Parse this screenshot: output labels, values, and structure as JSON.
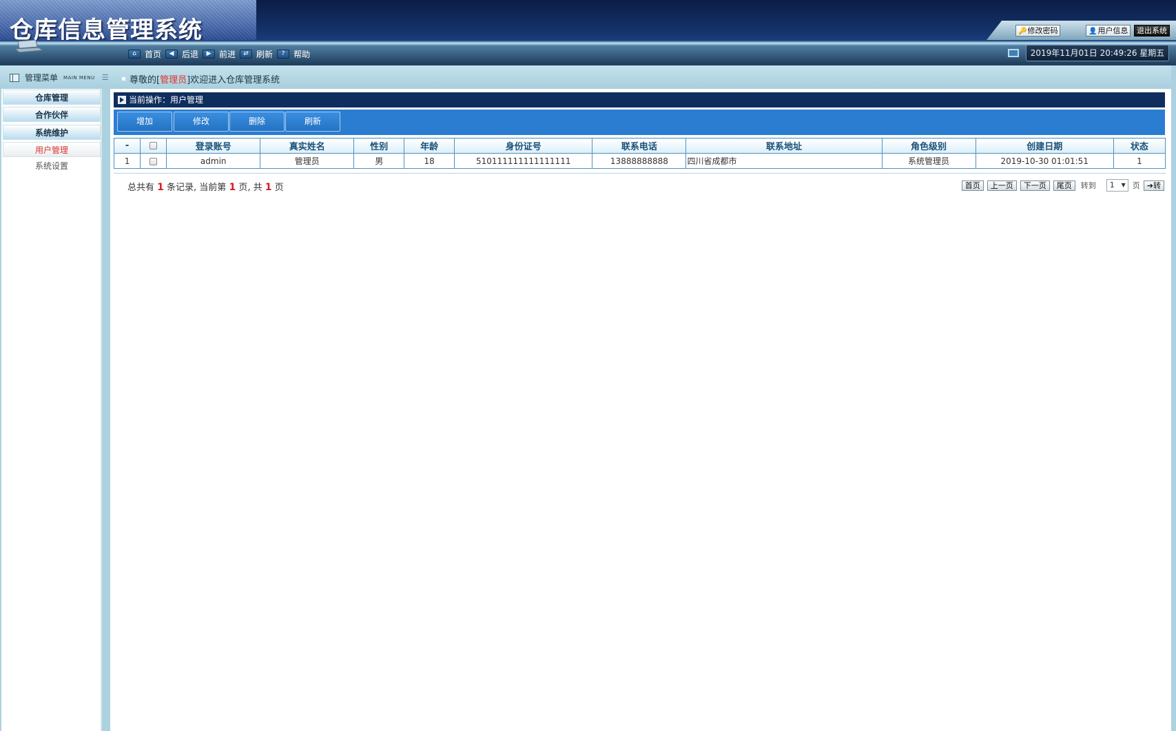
{
  "app": {
    "title": "仓库信息管理系统"
  },
  "top_actions": {
    "change_password": "修改密码",
    "user_info": "用户信息",
    "logout": "退出系统"
  },
  "nav": [
    {
      "label": "首页",
      "icon": "home-icon"
    },
    {
      "label": "后退",
      "icon": "back-arrow-icon"
    },
    {
      "label": "前进",
      "icon": "forward-arrow-icon"
    },
    {
      "label": "刷新",
      "icon": "refresh-icon"
    },
    {
      "label": "帮助",
      "icon": "help-icon"
    }
  ],
  "datetime": "2019年11月01日 20:49:26 星期五",
  "menu": {
    "title": "管理菜单",
    "title_en": "MAIN MENU",
    "items": [
      {
        "label": "仓库管理"
      },
      {
        "label": "合作伙伴"
      },
      {
        "label": "系统维护"
      },
      {
        "label": "用户管理"
      },
      {
        "label": "系统设置"
      }
    ]
  },
  "welcome": {
    "prefix": "尊敬的[",
    "role": "管理员",
    "suffix": "]欢迎进入仓库管理系统"
  },
  "current_op": "当前操作：用户管理",
  "toolbar": [
    "增加",
    "修改",
    "删除",
    "刷新"
  ],
  "table": {
    "columns": [
      "-",
      "",
      "登录账号",
      "真实姓名",
      "性别",
      "年龄",
      "身份证号",
      "联系电话",
      "联系地址",
      "角色级别",
      "创建日期",
      "状态"
    ],
    "rows": [
      [
        "1",
        "",
        "admin",
        "管理员",
        "男",
        "18",
        "510111111111111111",
        "13888888888",
        "四川省成都市",
        "系统管理员",
        "2019-10-30 01:01:51",
        "1"
      ]
    ]
  },
  "pager": {
    "info": {
      "p1": "总共有",
      "total": "1",
      "p2": "条记录, 当前第",
      "current": "1",
      "p3": "页, 共",
      "pages": "1",
      "p4": "页"
    },
    "first": "首页",
    "prev": "上一页",
    "next": "下一页",
    "last": "尾页",
    "goto_label": "转到",
    "page_value": "1",
    "page_label": "页",
    "go": "转"
  },
  "colors": {
    "header_dark": "#0b1d45",
    "toolbar_blue": "#2b7dd1",
    "op_bar": "#0f2e5e",
    "active_red": "#e0312d"
  }
}
